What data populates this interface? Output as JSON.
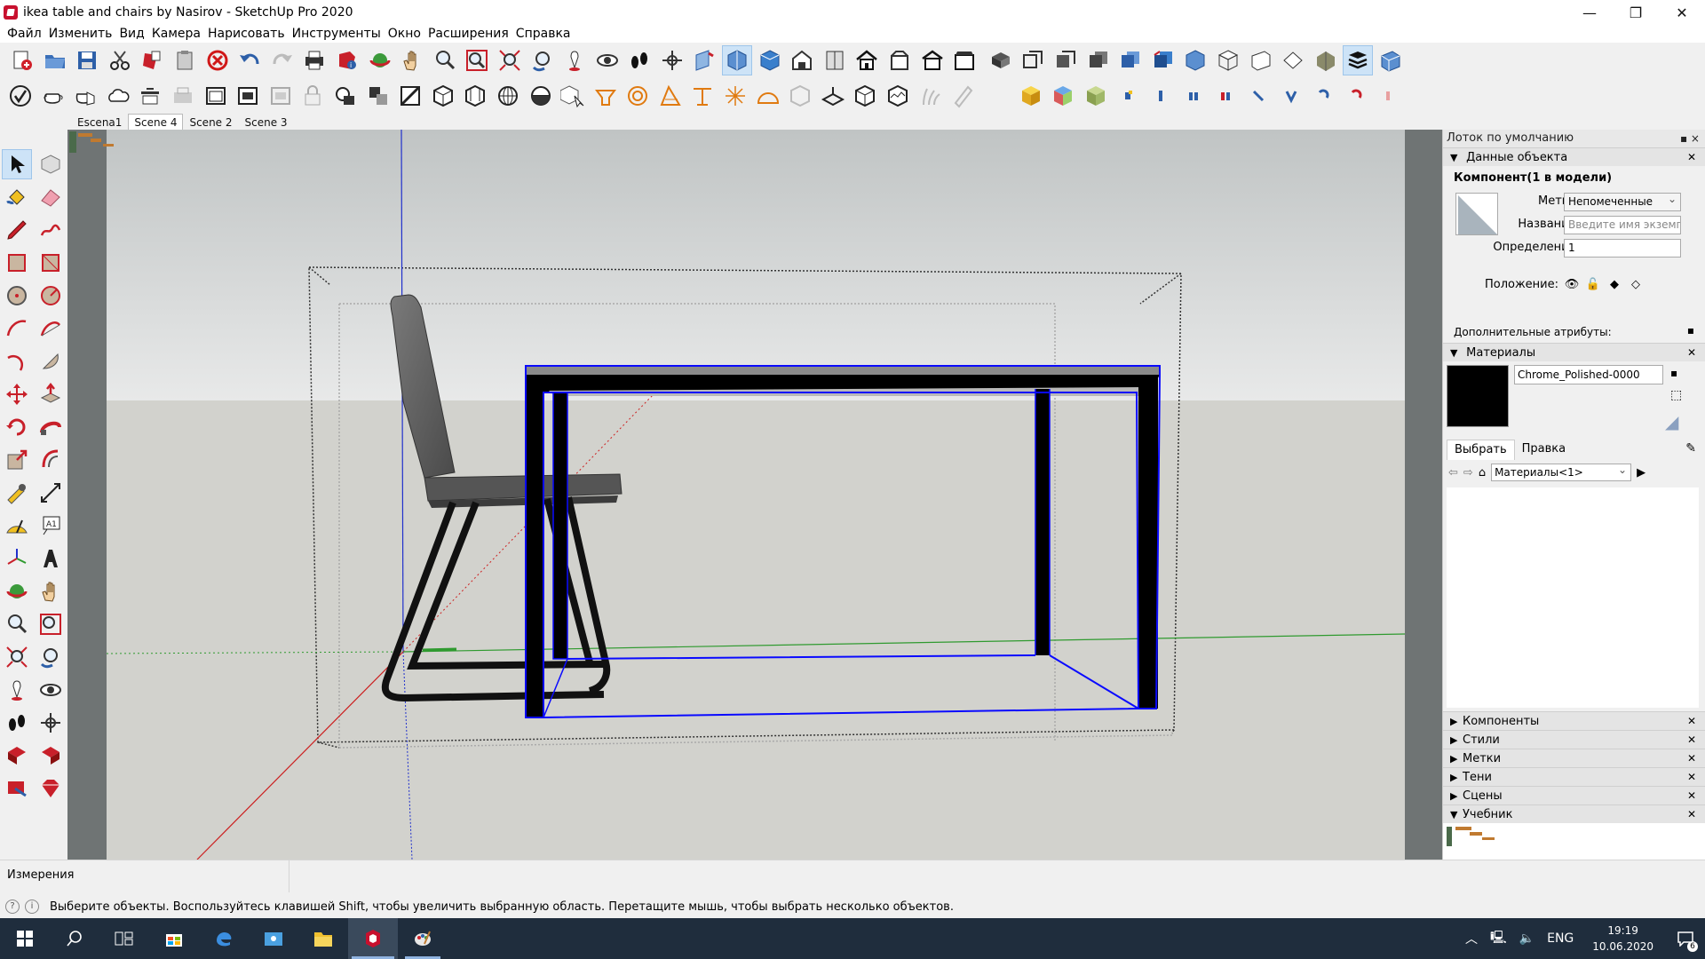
{
  "window": {
    "title": "ikea table and chairs by Nasirov - SketchUp Pro 2020",
    "minimize": "—",
    "maximize": "❐",
    "close": "✕"
  },
  "menu": [
    "Файл",
    "Изменить",
    "Вид",
    "Камера",
    "Нарисовать",
    "Инструменты",
    "Окно",
    "Расширения",
    "Справка"
  ],
  "scenes": [
    {
      "label": "Escena1",
      "active": false
    },
    {
      "label": "Scene 4",
      "active": true
    },
    {
      "label": "Scene 2",
      "active": false
    },
    {
      "label": "Scene 3",
      "active": false
    }
  ],
  "tray": {
    "title": "Лоток по умолчанию",
    "entity_info": {
      "header": "Данные объекта",
      "title": "Компонент(1 в модели)",
      "tag_label": "Метка:",
      "tag_value": "Непомеченные",
      "name_label": "Название:",
      "name_placeholder": "Введите имя экземпляра",
      "definition_label": "Определение:",
      "definition_value": "1",
      "position_label": "Положение:",
      "advanced_label": "Дополнительные атрибуты:"
    },
    "materials": {
      "header": "Материалы",
      "material_name": "Chrome_Polished-0000",
      "color": "#000000",
      "tab_select": "Выбрать",
      "tab_edit": "Правка",
      "collection": "Материалы<1>"
    },
    "collapsed_panels": [
      "Компоненты",
      "Стили",
      "Метки",
      "Тени",
      "Сцены"
    ],
    "tutorial": {
      "header": "Учебник"
    }
  },
  "measurements": {
    "label": "Измерения"
  },
  "status": {
    "text": "Выберите объекты. Воспользуйтесь клавишей Shift, чтобы увеличить выбранную область. Перетащите мышь, чтобы выбрать несколько объектов."
  },
  "taskbar": {
    "lang": "ENG",
    "time": "19:19",
    "date": "10.06.2020",
    "notifications": "6"
  },
  "colors": {
    "sky": "#c9cccc",
    "ground": "#d2d2cd",
    "axis_red": "#cc2020",
    "axis_green": "#2f9a2f",
    "axis_blue": "#2030cc",
    "selection_blue": "#0a0aff"
  }
}
